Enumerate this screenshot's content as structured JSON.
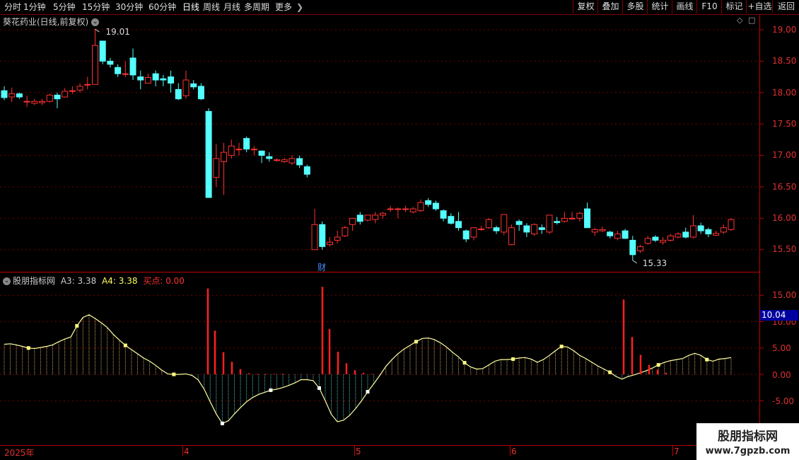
{
  "toolbar": {
    "tabs": [
      "分时",
      "1分钟",
      "5分钟",
      "15分钟",
      "30分钟",
      "60分钟",
      "日线",
      "周线",
      "月线",
      "多周期",
      "更多"
    ],
    "active_tab": "日线",
    "right_buttons": [
      "复权",
      "叠加",
      "多股",
      "统计",
      "画线",
      "F10",
      "标记",
      "+自选",
      "返回"
    ]
  },
  "main": {
    "title": "葵花药业(日线,前复权)",
    "price_ticks": [
      "19.00",
      "18.50",
      "18.00",
      "17.50",
      "17.00",
      "16.50",
      "16.00",
      "15.50"
    ],
    "high_label": "19.01",
    "low_label": "15.33",
    "event_marker": "财"
  },
  "indicator": {
    "name": "股朋指标网",
    "a3": "A3: 3.38",
    "a4": "A4: 3.38",
    "buy": "买点: 0.00",
    "ticks": [
      "15.00",
      "10.00",
      "5.00",
      "0.00",
      "-5.00"
    ],
    "current_value": "10.04"
  },
  "time_axis": {
    "labels": [
      "2025年",
      "4",
      "5",
      "6",
      "7"
    ]
  },
  "watermark": {
    "title": "股朋指标网",
    "url": "www.7gpzb.com"
  },
  "colors": {
    "up": "#ff3232",
    "down": "#54ffff",
    "axis": "#c00000",
    "line": "#ffff80"
  },
  "chart_data": [
    {
      "type": "candlestick",
      "title": "葵花药业(日线,前复权)",
      "x_labels": [
        "2025年",
        "4",
        "5",
        "6",
        "7"
      ],
      "ylim": [
        15.2,
        19.1
      ],
      "candles": [
        [
          18.03,
          17.92,
          18.1,
          17.88
        ],
        [
          17.93,
          17.98,
          18.08,
          17.85
        ],
        [
          17.98,
          17.93,
          18.0,
          17.9
        ],
        [
          17.86,
          17.86,
          17.95,
          17.77
        ],
        [
          17.83,
          17.86,
          17.9,
          17.8
        ],
        [
          17.84,
          17.86,
          17.9,
          17.8
        ],
        [
          17.86,
          17.96,
          17.98,
          17.84
        ],
        [
          17.96,
          17.9,
          18.0,
          17.75
        ],
        [
          17.93,
          18.02,
          18.07,
          17.92
        ],
        [
          18.03,
          18.03,
          18.1,
          17.98
        ],
        [
          18.04,
          18.1,
          18.15,
          18.0
        ],
        [
          18.12,
          18.13,
          18.25,
          18.05
        ],
        [
          18.13,
          18.75,
          19.01,
          18.13
        ],
        [
          18.82,
          18.5,
          18.82,
          18.45
        ],
        [
          18.5,
          18.45,
          18.55,
          18.4
        ],
        [
          18.4,
          18.3,
          18.45,
          18.25
        ],
        [
          18.3,
          18.3,
          18.5,
          18.25
        ],
        [
          18.55,
          18.28,
          18.7,
          18.2
        ],
        [
          18.25,
          18.2,
          18.35,
          18.05
        ],
        [
          18.15,
          18.24,
          18.3,
          18.15
        ],
        [
          18.3,
          18.2,
          18.35,
          18.1
        ],
        [
          18.22,
          18.2,
          18.28,
          18.1
        ],
        [
          18.25,
          18.15,
          18.35,
          18.0
        ],
        [
          18.05,
          17.9,
          18.15,
          17.88
        ],
        [
          17.95,
          18.2,
          18.35,
          17.9
        ],
        [
          18.14,
          18.09,
          18.2,
          18.05
        ],
        [
          18.1,
          17.9,
          18.15,
          17.88
        ],
        [
          17.7,
          16.33,
          17.75,
          16.33
        ],
        [
          16.65,
          16.95,
          17.18,
          16.5
        ],
        [
          16.9,
          17.05,
          17.2,
          16.37
        ],
        [
          17.0,
          17.15,
          17.25,
          16.95
        ],
        [
          17.1,
          17.1,
          17.2,
          17.0
        ],
        [
          17.27,
          17.1,
          17.3,
          17.05
        ],
        [
          17.1,
          17.1,
          17.15,
          17.0
        ],
        [
          17.07,
          17.0,
          17.08,
          16.88
        ],
        [
          16.98,
          16.95,
          17.05,
          16.9
        ],
        [
          16.93,
          16.93,
          16.95,
          16.9
        ],
        [
          16.9,
          16.93,
          16.96,
          16.88
        ],
        [
          16.88,
          16.95,
          17.0,
          16.85
        ],
        [
          16.95,
          16.85,
          17.0,
          16.8
        ],
        [
          16.82,
          16.7,
          16.85,
          16.65
        ],
        [
          15.5,
          15.9,
          16.15,
          15.5
        ],
        [
          15.9,
          15.55,
          15.95,
          15.5
        ],
        [
          15.58,
          15.62,
          15.7,
          15.55
        ],
        [
          15.65,
          15.7,
          15.8,
          15.6
        ],
        [
          15.72,
          15.85,
          15.88,
          15.7
        ],
        [
          15.9,
          16.0,
          16.0,
          15.8
        ],
        [
          16.05,
          15.95,
          16.1,
          15.9
        ],
        [
          15.97,
          16.05,
          16.05,
          15.95
        ],
        [
          15.98,
          16.05,
          16.1,
          15.92
        ],
        [
          16.05,
          16.08,
          16.1,
          16.0
        ],
        [
          16.15,
          16.15,
          16.2,
          16.1
        ],
        [
          16.15,
          16.15,
          16.17,
          16.0
        ],
        [
          16.15,
          16.15,
          16.2,
          16.1
        ],
        [
          16.1,
          16.15,
          16.18,
          16.08
        ],
        [
          16.12,
          16.25,
          16.3,
          16.1
        ],
        [
          16.28,
          16.22,
          16.32,
          16.18
        ],
        [
          16.24,
          16.15,
          16.28,
          16.12
        ],
        [
          16.12,
          16.0,
          16.14,
          15.95
        ],
        [
          16.03,
          15.92,
          16.08,
          15.9
        ],
        [
          15.95,
          15.85,
          16.1,
          15.8
        ],
        [
          15.8,
          15.67,
          15.82,
          15.62
        ],
        [
          15.7,
          15.85,
          15.86,
          15.65
        ],
        [
          15.82,
          15.83,
          15.88,
          15.8
        ],
        [
          15.85,
          15.98,
          16.0,
          15.83
        ],
        [
          15.85,
          15.8,
          15.88,
          15.75
        ],
        [
          15.78,
          16.06,
          16.06,
          15.73
        ],
        [
          15.58,
          15.85,
          15.9,
          15.57
        ],
        [
          15.95,
          15.9,
          15.98,
          15.8
        ],
        [
          15.88,
          15.78,
          15.92,
          15.7
        ],
        [
          15.75,
          15.9,
          15.92,
          15.72
        ],
        [
          15.85,
          15.82,
          15.9,
          15.75
        ],
        [
          15.78,
          16.05,
          16.05,
          15.75
        ],
        [
          15.95,
          15.93,
          16.02,
          15.9
        ],
        [
          15.95,
          16.0,
          16.1,
          15.93
        ],
        [
          16.0,
          16.0,
          16.1,
          15.98
        ],
        [
          16.0,
          16.08,
          16.1,
          15.95
        ],
        [
          16.15,
          15.85,
          16.25,
          15.85
        ],
        [
          15.78,
          15.82,
          15.85,
          15.72
        ],
        [
          15.8,
          15.82,
          15.87,
          15.78
        ],
        [
          15.78,
          15.72,
          15.8,
          15.68
        ],
        [
          15.68,
          15.75,
          15.8,
          15.65
        ],
        [
          15.8,
          15.68,
          15.83,
          15.67
        ],
        [
          15.65,
          15.42,
          15.72,
          15.33
        ],
        [
          15.48,
          15.55,
          15.58,
          15.45
        ],
        [
          15.6,
          15.68,
          15.72,
          15.58
        ],
        [
          15.7,
          15.65,
          15.73,
          15.62
        ],
        [
          15.62,
          15.65,
          15.7,
          15.58
        ],
        [
          15.65,
          15.72,
          15.75,
          15.63
        ],
        [
          15.7,
          15.75,
          15.78,
          15.68
        ],
        [
          15.78,
          15.7,
          15.85,
          15.68
        ],
        [
          15.7,
          15.88,
          16.05,
          15.68
        ],
        [
          15.88,
          15.8,
          15.93,
          15.75
        ],
        [
          15.82,
          15.75,
          15.85,
          15.7
        ],
        [
          15.73,
          15.76,
          15.8,
          15.72
        ],
        [
          15.78,
          15.85,
          15.9,
          15.75
        ],
        [
          15.82,
          15.98,
          16.0,
          15.8
        ]
      ]
    },
    {
      "type": "line",
      "title": "股朋指标网",
      "ylim": [
        -8.5,
        17
      ],
      "series": [
        {
          "name": "A3",
          "values": [
            5.7,
            5.8,
            5.6,
            5.3,
            5.0,
            4.9,
            5.1,
            5.3,
            5.6,
            6.2,
            6.7,
            7.1,
            9.2,
            10.8,
            11.3,
            10.6,
            9.8,
            8.9,
            7.6,
            6.5,
            5.5,
            4.7,
            3.9,
            3.1,
            2.5,
            1.7,
            0.8,
            0.1,
            0.0,
            0.0,
            0.1,
            -0.2,
            -1.0,
            -2.8,
            -5.2,
            -7.5,
            -9.3,
            -8.8,
            -7.5,
            -6.3,
            -5.2,
            -4.4,
            -3.8,
            -3.4,
            -3.0,
            -2.8,
            -2.5,
            -2.1,
            -1.6,
            -1.0,
            -1.0,
            -1.2,
            -2.6,
            -5.0,
            -7.6,
            -9.0,
            -8.7,
            -7.8,
            -6.5,
            -5.0,
            -3.3,
            -1.8,
            -0.2,
            1.5,
            2.8,
            3.9,
            4.8,
            5.5,
            6.2,
            6.8,
            6.9,
            6.6,
            6.0,
            5.2,
            4.2,
            3.3,
            2.2,
            1.4,
            1.0,
            1.1,
            1.8,
            2.5,
            2.8,
            2.8,
            2.9,
            3.1,
            3.2,
            2.9,
            2.3,
            2.8,
            3.6,
            4.5,
            5.3,
            5.2,
            4.5,
            3.6,
            3.0,
            2.3,
            1.6,
            1.0,
            0.4,
            -0.4,
            -0.9,
            -0.4,
            -0.1,
            0.3,
            0.7,
            1.2,
            1.8,
            2.3,
            2.6,
            2.8,
            3.0,
            3.6,
            4.0,
            3.6,
            2.8,
            2.5,
            2.9,
            3.0,
            3.2
          ]
        },
        {
          "name": "买点",
          "values": [
            16.3,
            8.3,
            4.2,
            2.4,
            1.0,
            0.2,
            0.1,
            0.1,
            0.1,
            0.1,
            16.6,
            8.6,
            4.3,
            2.1,
            0.8,
            0.3,
            0.1,
            14.2,
            7.1,
            3.7,
            1.8,
            0.9,
            0.3
          ]
        }
      ]
    }
  ]
}
